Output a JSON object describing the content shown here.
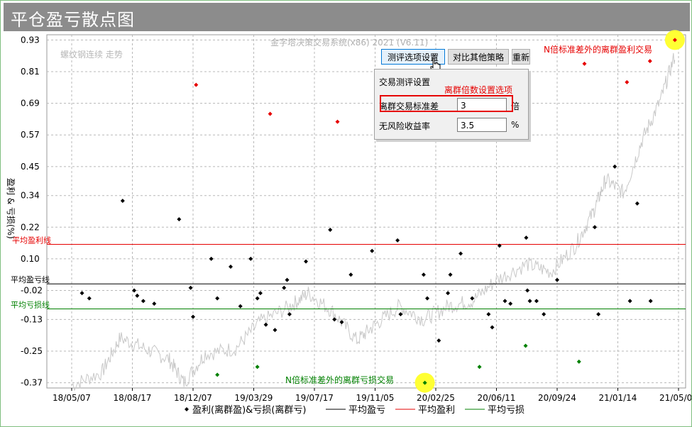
{
  "header": {
    "title": "平仓盈亏散点图"
  },
  "watermark": "金字塔决策交易系统(x86) 2021 (V6.11)",
  "subtitle": "螺纹钢连续 走势",
  "annotations": {
    "outlier_profit": "N倍标准差外的离群盈利交易",
    "outlier_loss": "N倍标准差外的离群亏损交易",
    "avg_profit_line": "平均盈利线",
    "avg_pnl_line": "平均盈亏线",
    "avg_loss_line": "平均亏损线"
  },
  "dialog": {
    "buttons": [
      "测评选项设置",
      "对比其他策略",
      "重新"
    ],
    "title": "交易测评设置",
    "note": "离群倍数设置选项",
    "row1_label": "离群交易标准差",
    "row1_value": "3",
    "row1_unit": "倍",
    "row2_label": "无风险收益率",
    "row2_value": "3.5",
    "row2_unit": "%"
  },
  "colors": {
    "profit_line": "#e60000",
    "pnl_line": "#000000",
    "loss_line": "#008000",
    "outlier_profit": "#e60000",
    "outlier_loss": "#008000",
    "normal": "#000000",
    "price": "#c8c8c8",
    "highlight": "#ffff33"
  },
  "chart_data": {
    "type": "scatter",
    "ylabel": "盈利 & 亏损(%)",
    "yticks": [
      0.93,
      0.81,
      0.69,
      0.57,
      0.45,
      0.34,
      0.22,
      0.1,
      -0.02,
      -0.13,
      -0.25,
      -0.37
    ],
    "ylim": [
      -0.39,
      0.95
    ],
    "xticks": [
      "18/05/07",
      "18/08/17",
      "18/12/07",
      "19/03/29",
      "19/07/17",
      "19/11/05",
      "20/02/25",
      "20/06/11",
      "20/09/24",
      "21/01/14",
      "21/05/07"
    ],
    "xlim": [
      0,
      10
    ],
    "avg_profit": 0.155,
    "avg_pnl": 0.005,
    "avg_loss": -0.09,
    "legend": [
      {
        "marker": "diamond",
        "label": "盈利(离群盈)&亏损(离群亏)"
      },
      {
        "marker": "line",
        "label": "平均盈亏"
      },
      {
        "marker": "line",
        "label": "平均盈利"
      },
      {
        "marker": "line",
        "label": "平均亏损"
      }
    ],
    "series": [
      {
        "name": "盈利(离群盈)&亏损(离群亏)",
        "kind": "normal",
        "points": [
          [
            0.17,
            -0.03
          ],
          [
            0.29,
            -0.05
          ],
          [
            0.84,
            0.32
          ],
          [
            1.03,
            -0.02
          ],
          [
            1.08,
            -0.04
          ],
          [
            1.18,
            -0.06
          ],
          [
            1.36,
            -0.07
          ],
          [
            1.77,
            0.25
          ],
          [
            1.96,
            -0.01
          ],
          [
            2.0,
            -0.12
          ],
          [
            2.3,
            0.1
          ],
          [
            2.4,
            -0.05
          ],
          [
            2.62,
            0.07
          ],
          [
            2.78,
            -0.08
          ],
          [
            2.95,
            0.1
          ],
          [
            3.11,
            -0.03
          ],
          [
            3.06,
            -0.05
          ],
          [
            3.2,
            -0.15
          ],
          [
            3.35,
            -0.17
          ],
          [
            3.5,
            -0.01
          ],
          [
            3.55,
            0.02
          ],
          [
            3.59,
            -0.11
          ],
          [
            3.86,
            0.09
          ],
          [
            4.26,
            0.21
          ],
          [
            4.33,
            -0.13
          ],
          [
            4.45,
            -0.14
          ],
          [
            4.6,
            0.04
          ],
          [
            4.95,
            0.13
          ],
          [
            5.37,
            0.17
          ],
          [
            5.42,
            -0.11
          ],
          [
            5.8,
            0.04
          ],
          [
            5.86,
            -0.05
          ],
          [
            6.05,
            -0.21
          ],
          [
            6.2,
            -0.03
          ],
          [
            6.24,
            0.04
          ],
          [
            6.41,
            0.12
          ],
          [
            6.6,
            -0.05
          ],
          [
            6.87,
            -0.11
          ],
          [
            6.93,
            -0.16
          ],
          [
            7.05,
            0.15
          ],
          [
            7.14,
            -0.06
          ],
          [
            7.23,
            -0.07
          ],
          [
            7.49,
            0.18
          ],
          [
            7.51,
            -0.02
          ],
          [
            7.55,
            -0.06
          ],
          [
            7.66,
            -0.06
          ],
          [
            7.78,
            -0.11
          ],
          [
            8.0,
            0.02
          ],
          [
            8.62,
            0.22
          ],
          [
            8.68,
            -0.11
          ],
          [
            8.95,
            0.45
          ],
          [
            9.32,
            0.31
          ],
          [
            9.2,
            -0.06
          ],
          [
            9.54,
            -0.06
          ]
        ]
      },
      {
        "name": "离群盈",
        "kind": "outlier_profit",
        "points": [
          [
            2.05,
            0.76
          ],
          [
            3.27,
            0.65
          ],
          [
            4.38,
            0.62
          ],
          [
            8.45,
            0.84
          ],
          [
            9.15,
            0.77
          ],
          [
            9.53,
            0.85
          ],
          [
            9.94,
            0.93
          ]
        ]
      },
      {
        "name": "离群亏",
        "kind": "outlier_loss",
        "points": [
          [
            2.4,
            -0.34
          ],
          [
            3.06,
            -0.31
          ],
          [
            5.82,
            -0.37
          ],
          [
            6.72,
            -0.31
          ],
          [
            7.48,
            -0.23
          ],
          [
            8.36,
            -0.29
          ]
        ]
      }
    ]
  }
}
